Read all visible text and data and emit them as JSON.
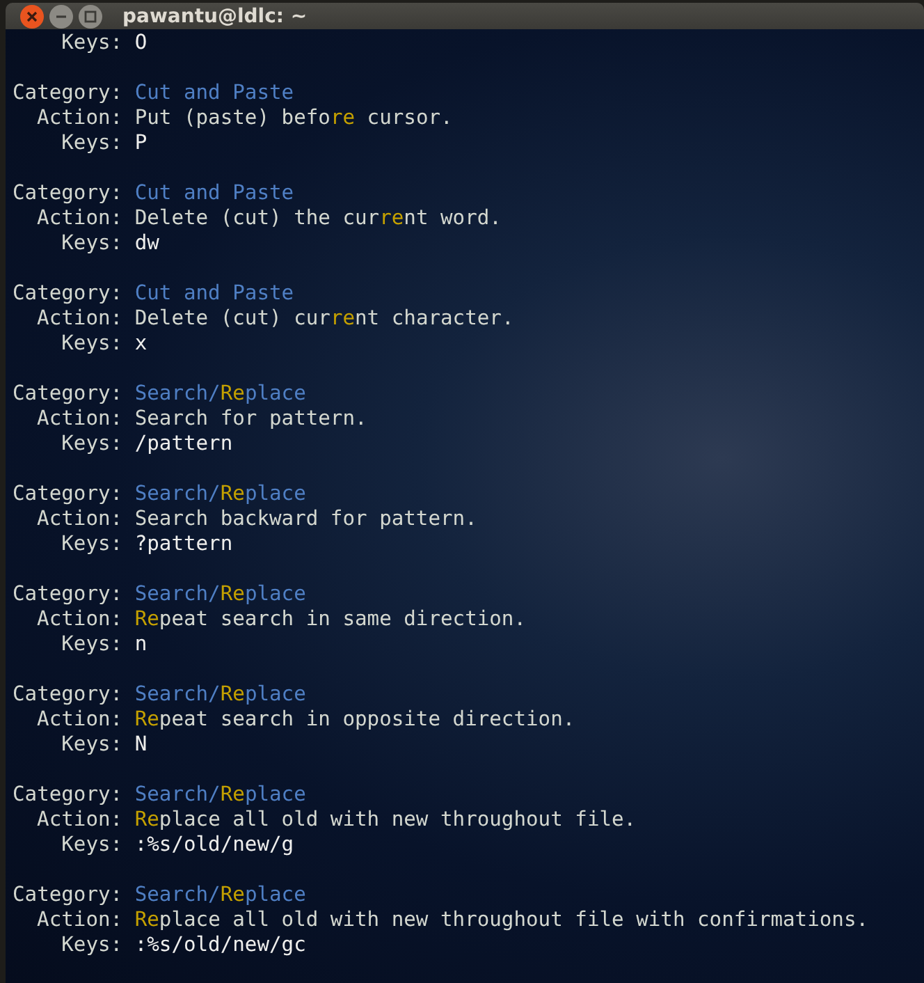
{
  "window": {
    "title": "pawantu@ldlc: ~"
  },
  "entries": [
    {
      "lines": [
        {
          "kind": "keys",
          "label": "Keys:",
          "value": "O"
        }
      ]
    },
    {
      "lines": [
        {
          "kind": "category",
          "label": "Category:",
          "value": "Cut and Paste"
        },
        {
          "kind": "action",
          "label": "Action:",
          "value": "Put (paste) befo**re** cursor."
        },
        {
          "kind": "keys",
          "label": "Keys:",
          "value": "P"
        }
      ]
    },
    {
      "lines": [
        {
          "kind": "category",
          "label": "Category:",
          "value": "Cut and Paste"
        },
        {
          "kind": "action",
          "label": "Action:",
          "value": "Delete (cut) the cur**re**nt word."
        },
        {
          "kind": "keys",
          "label": "Keys:",
          "value": "dw"
        }
      ]
    },
    {
      "lines": [
        {
          "kind": "category",
          "label": "Category:",
          "value": "Cut and Paste"
        },
        {
          "kind": "action",
          "label": "Action:",
          "value": "Delete (cut) cur**re**nt character."
        },
        {
          "kind": "keys",
          "label": "Keys:",
          "value": "x"
        }
      ]
    },
    {
      "lines": [
        {
          "kind": "category",
          "label": "Category:",
          "value": "Search/**Re**place"
        },
        {
          "kind": "action",
          "label": "Action:",
          "value": "Search for pattern."
        },
        {
          "kind": "keys",
          "label": "Keys:",
          "value": "/pattern"
        }
      ]
    },
    {
      "lines": [
        {
          "kind": "category",
          "label": "Category:",
          "value": "Search/**Re**place"
        },
        {
          "kind": "action",
          "label": "Action:",
          "value": "Search backward for pattern."
        },
        {
          "kind": "keys",
          "label": "Keys:",
          "value": "?pattern"
        }
      ]
    },
    {
      "lines": [
        {
          "kind": "category",
          "label": "Category:",
          "value": "Search/**Re**place"
        },
        {
          "kind": "action",
          "label": "Action:",
          "value": "**Re**peat search in same direction."
        },
        {
          "kind": "keys",
          "label": "Keys:",
          "value": "n"
        }
      ]
    },
    {
      "lines": [
        {
          "kind": "category",
          "label": "Category:",
          "value": "Search/**Re**place"
        },
        {
          "kind": "action",
          "label": "Action:",
          "value": "**Re**peat search in opposite direction."
        },
        {
          "kind": "keys",
          "label": "Keys:",
          "value": "N"
        }
      ]
    },
    {
      "lines": [
        {
          "kind": "category",
          "label": "Category:",
          "value": "Search/**Re**place"
        },
        {
          "kind": "action",
          "label": "Action:",
          "value": "**Re**place all old with new throughout file."
        },
        {
          "kind": "keys",
          "label": "Keys:",
          "value": ":%s/old/new/g"
        }
      ]
    },
    {
      "lines": [
        {
          "kind": "category",
          "label": "Category:",
          "value": "Search/**Re**place"
        },
        {
          "kind": "action",
          "label": "Action:",
          "value": "**Re**place all old with new throughout file with confirmations."
        },
        {
          "kind": "keys",
          "label": "Keys:",
          "value": ":%s/old/new/gc"
        }
      ]
    }
  ]
}
